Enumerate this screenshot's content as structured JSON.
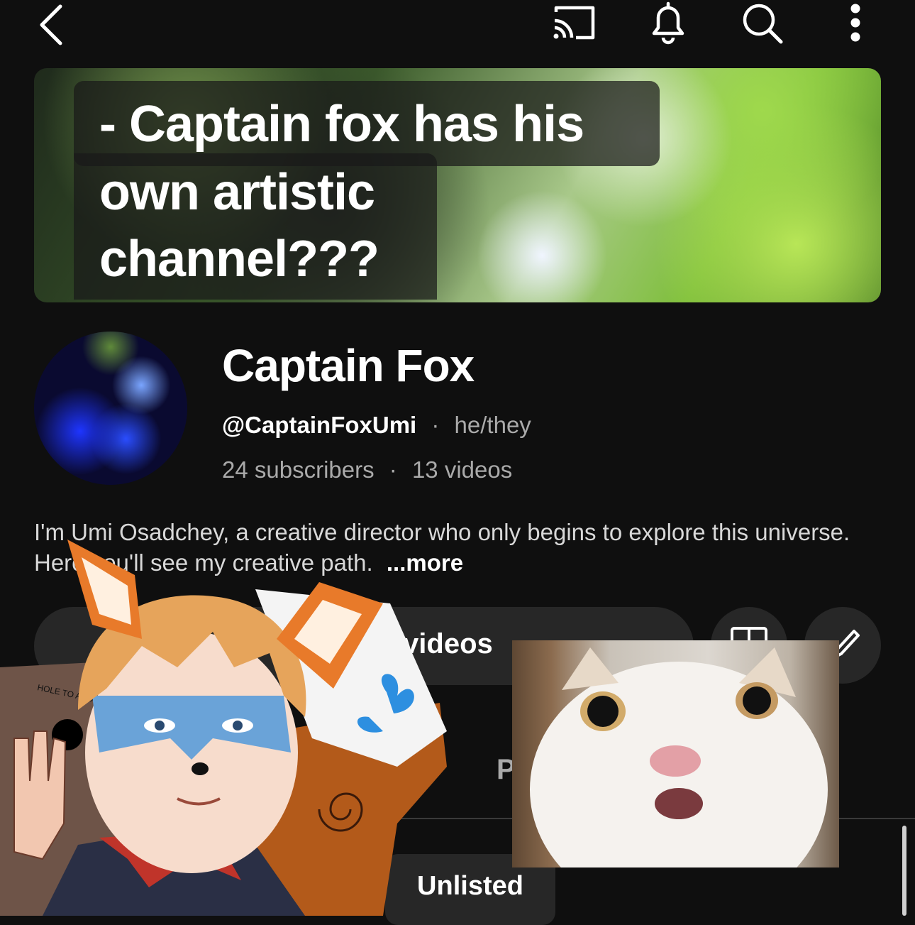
{
  "topbar": {
    "back_icon": "chevron-left-icon",
    "cast_icon": "cast-icon",
    "notifications_icon": "bell-icon",
    "search_icon": "search-icon",
    "more_icon": "more-vertical-icon"
  },
  "banner": {
    "line1": "- Captain fox has his",
    "line2": "own artistic",
    "line3": "channel???"
  },
  "channel": {
    "name": "Captain Fox",
    "handle": "@CaptainFoxUmi",
    "pronouns": "he/they",
    "subscribers": "24 subscribers",
    "videos": "13 videos",
    "separator": "·"
  },
  "description": {
    "text": "I'm Umi Osadchey, a creative director who only begins to explore this universe. Here you'll see my creative path.",
    "more": "...more"
  },
  "actions": {
    "manage_videos_label": "Manage videos",
    "stats_icon": "analytics-icon",
    "edit_icon": "pencil-icon"
  },
  "tabs": {
    "partial_label": "P"
  },
  "filter": {
    "unlisted_label": "Unlisted"
  },
  "sticker": {
    "handwritten_note": "HOLE TO ANOTHER UNIVERSE"
  },
  "colors": {
    "background": "#0f0f0f",
    "surface": "#272727",
    "text_primary": "#f1f1f1",
    "text_secondary": "#aaaaaa"
  }
}
